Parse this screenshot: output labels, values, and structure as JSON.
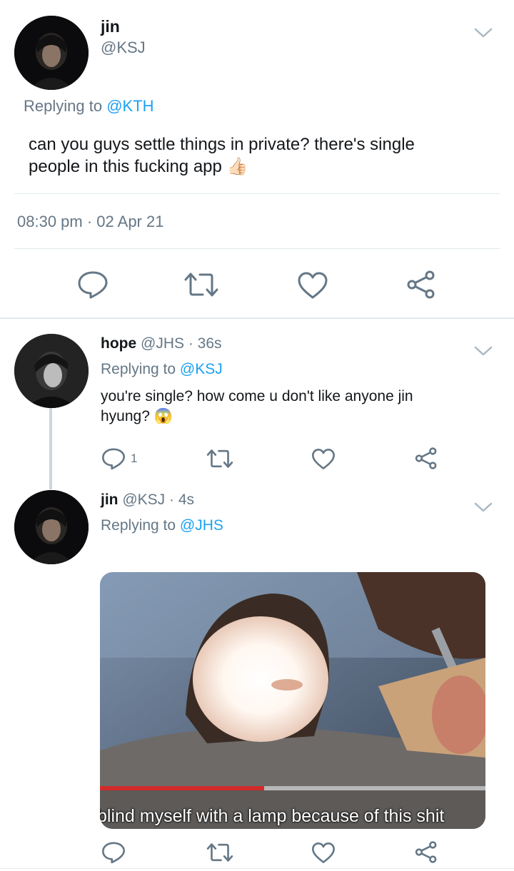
{
  "colors": {
    "accent": "#1da1f2",
    "secondary_text": "#657786",
    "divider": "#e1e8ed"
  },
  "main_tweet": {
    "display_name": "jin",
    "handle": "@KSJ",
    "replying_prefix": "Replying to",
    "replying_handle": "@KTH",
    "text_line1": "can you guys settle things in private? there's single",
    "text_line2": "people in this fucking app",
    "emoji": "👍🏻",
    "timestamp": "08:30 pm · 02 Apr 21",
    "actions": [
      "reply-icon",
      "retweet-icon",
      "like-icon",
      "share-icon"
    ]
  },
  "replies": [
    {
      "display_name": "hope",
      "handle": "@JHS",
      "time": "· 36s",
      "replying_prefix": "Replying to",
      "replying_handle": "@KSJ",
      "text_line1": "you're single? how come u don't like anyone jin",
      "text_line2": "hyung?",
      "emoji": "😱",
      "reply_count": "1"
    },
    {
      "display_name": "jin",
      "handle": "@KSJ",
      "time": "· 4s",
      "replying_prefix": "Replying to",
      "replying_handle": "@JHS",
      "media_caption": "blind myself with a lamp because of this shit"
    }
  ]
}
